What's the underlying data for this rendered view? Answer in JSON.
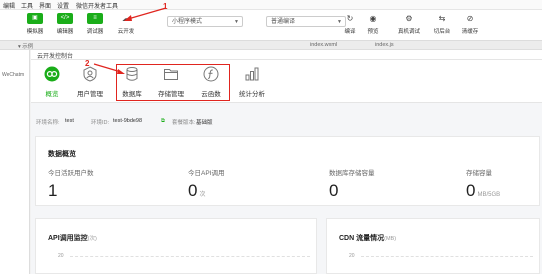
{
  "menu": [
    "编辑",
    "工具",
    "界面",
    "设置",
    "微信开发者工具"
  ],
  "toolbar": {
    "buttons": [
      {
        "label": "模拟器",
        "glyph": "▣"
      },
      {
        "label": "编辑器",
        "glyph": "</>"
      },
      {
        "label": "调试器",
        "glyph": "≡"
      }
    ],
    "cloud_label": "云开发",
    "mode_select": "小程序模式",
    "compile_select": "普通编译",
    "right_buttons": [
      {
        "label": "编译",
        "glyph": "↻"
      },
      {
        "label": "预览",
        "glyph": "◉"
      },
      {
        "label": "真机调试",
        "glyph": "⚙"
      },
      {
        "label": "切后台",
        "glyph": "⇆"
      },
      {
        "label": "清缓存",
        "glyph": "⊘"
      }
    ],
    "annotation": "1"
  },
  "tabs_row": [
    "▾ 示例",
    "index.wxml",
    "index.js"
  ],
  "simulator_text": "WeChatm",
  "window_title": "云开发控制台",
  "nav": {
    "items": [
      {
        "label": "概览",
        "icon": "overview-icon"
      },
      {
        "label": "用户管理",
        "icon": "user-icon"
      },
      {
        "label": "数据库",
        "icon": "database-icon"
      },
      {
        "label": "存储管理",
        "icon": "folder-icon"
      },
      {
        "label": "云函数",
        "icon": "function-icon"
      },
      {
        "label": "统计分析",
        "icon": "chart-icon"
      }
    ],
    "active_index": 0,
    "annotation": "2"
  },
  "env": {
    "name_label": "环境名称:",
    "name_value": "test",
    "id_label": "环境ID:",
    "id_value": "test-9bde98",
    "plan_label": "套餐版本:",
    "plan_value": "基础版"
  },
  "overview": {
    "title": "数据概览",
    "metrics": [
      {
        "label": "今日活跃用户数",
        "value": "1",
        "unit": ""
      },
      {
        "label": "今日API调用",
        "value": "0",
        "unit": "次"
      },
      {
        "label": "数据库存储容量",
        "value": "0",
        "unit": ""
      },
      {
        "label": "存储容量",
        "value": "0",
        "unit": "MB/5GB"
      }
    ]
  },
  "api_card": {
    "title": "API调用监控",
    "sub": "(次)",
    "tick": "20"
  },
  "cdn_card": {
    "title": "CDN 流量情况",
    "sub": "(MB)",
    "tick": "20"
  },
  "colors": {
    "accent": "#1aad19",
    "annotation": "#e0251f"
  }
}
